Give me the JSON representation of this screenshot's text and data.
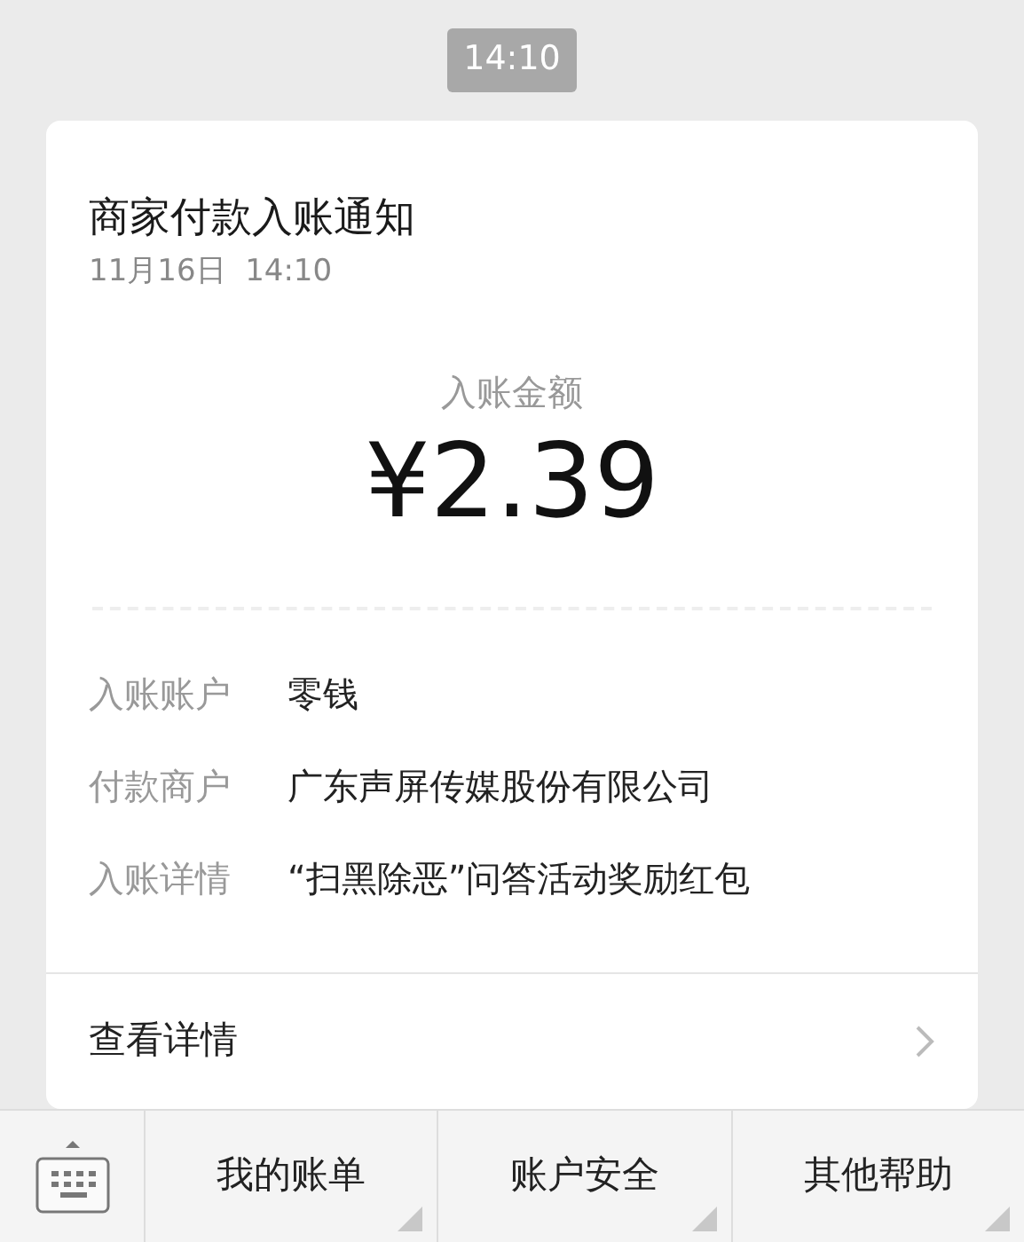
{
  "timestamp": "14:10",
  "card": {
    "title": "商家付款入账通知",
    "date": "11月16日  14:10",
    "amount_label": "入账金额",
    "amount": "¥2.39",
    "fields": [
      {
        "label": "入账账户",
        "value": "零钱"
      },
      {
        "label": "付款商户",
        "value": "广东声屏传媒股份有限公司"
      },
      {
        "label": "入账详情",
        "value": "“扫黑除恶”问答活动奖励红包"
      }
    ],
    "link": "查看详情"
  },
  "menu": [
    {
      "label": "我的账单",
      "has_submenu": true
    },
    {
      "label": "账户安全",
      "has_submenu": true
    },
    {
      "label": "其他帮助",
      "has_submenu": true
    }
  ]
}
